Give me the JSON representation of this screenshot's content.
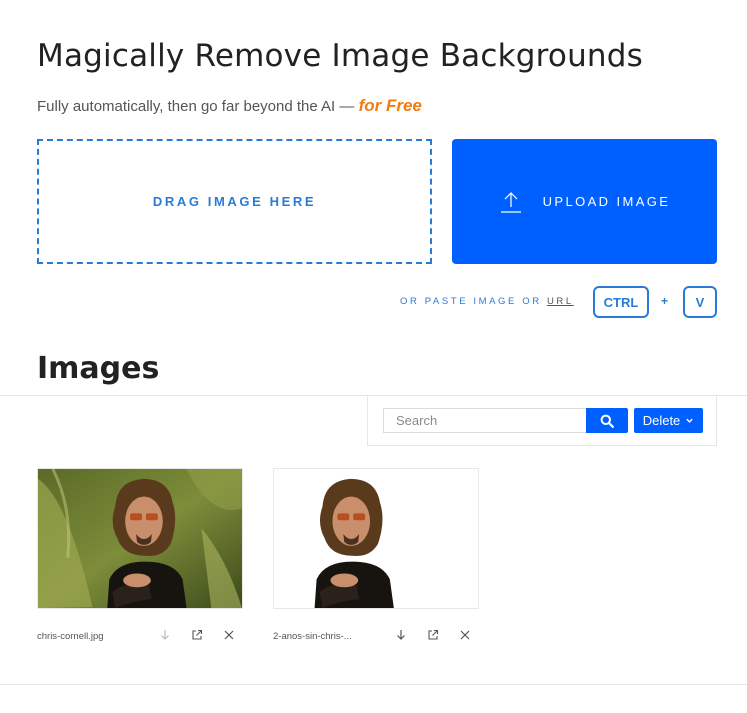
{
  "header": {
    "title": "Magically Remove Image Backgrounds",
    "subtitle": "Fully automatically, then go far beyond the AI —",
    "subtitle_emphasis": "for Free"
  },
  "upload": {
    "dropzone_label": "DRAG IMAGE HERE",
    "button_label": "UPLOAD IMAGE",
    "paste_text": "OR PASTE IMAGE OR",
    "url_link": "URL",
    "key_ctrl": "CTRL",
    "key_plus": "+",
    "key_v": "V"
  },
  "images": {
    "heading": "Images",
    "search_placeholder": "Search",
    "delete_label": "Delete",
    "items": [
      {
        "filename": "chris-cornell.jpg",
        "background": "photo"
      },
      {
        "filename": "2-anos-sin-chris-...",
        "background": "removed"
      }
    ]
  },
  "colors": {
    "primary": "#0060ff",
    "accent_blue": "#2a7bd8",
    "accent_orange": "#f07c12"
  },
  "icons": [
    "upload-icon",
    "search-icon",
    "chevron-down-icon",
    "download-icon",
    "open-external-icon",
    "close-icon"
  ]
}
